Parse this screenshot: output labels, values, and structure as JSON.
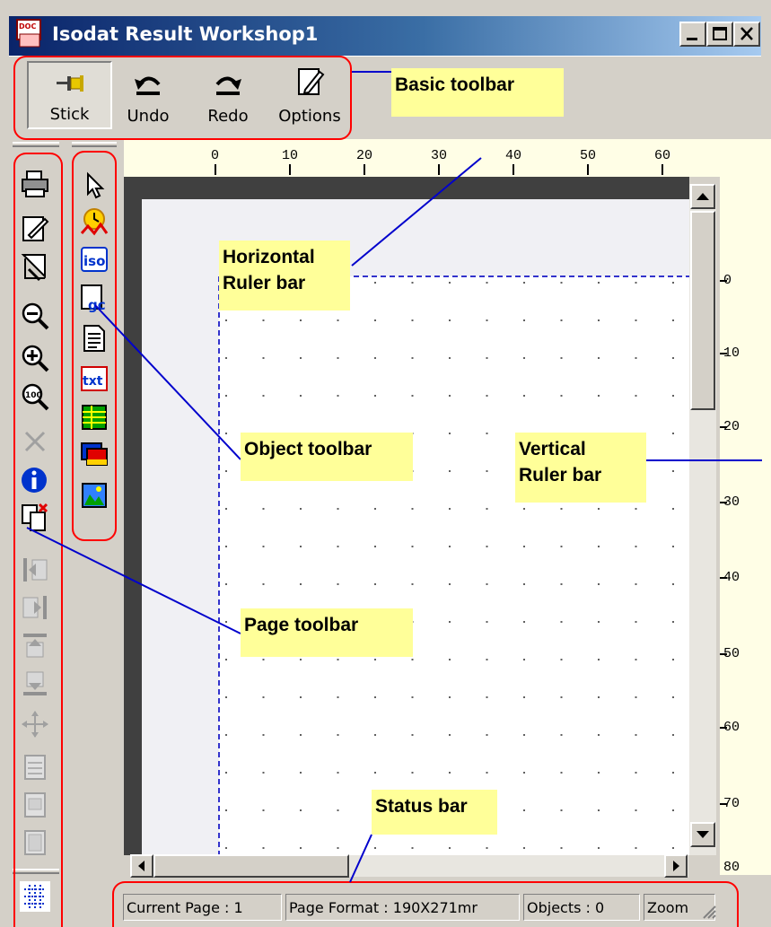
{
  "window": {
    "title": "Isodat Result Workshop1",
    "caption_buttons": {
      "minimize": "_",
      "maximize": "□",
      "close": "×"
    }
  },
  "basic_toolbar": {
    "buttons": [
      {
        "label": "Stick",
        "icon": "pin-icon"
      },
      {
        "label": "Undo",
        "icon": "undo-arrow-icon"
      },
      {
        "label": "Redo",
        "icon": "redo-arrow-icon"
      },
      {
        "label": "Options",
        "icon": "notepad-pencil-icon"
      }
    ]
  },
  "page_toolbar": {
    "icons": [
      "print-icon",
      "edit-page-icon",
      "page-select-icon",
      "zoom-out-icon",
      "zoom-in-icon",
      "zoom-100-icon",
      "delete-icon",
      "info-icon",
      "copy-page-icon",
      "move-left-icon",
      "move-right-icon",
      "move-up-icon",
      "move-down-icon",
      "move-center-icon",
      "page-layout-1-icon",
      "page-layout-2-icon",
      "page-layout-3-icon",
      "grid-icon"
    ]
  },
  "object_toolbar": {
    "icons": [
      "pointer-icon",
      "chromatogram-icon",
      "iso-object-icon",
      "gc-object-icon",
      "text-document-icon",
      "txt-object-icon",
      "table-object-icon",
      "image-object-icon",
      "picture-object-icon"
    ]
  },
  "horizontal_ruler": {
    "labels": [
      "0",
      "10",
      "20",
      "30",
      "40",
      "50",
      "60"
    ]
  },
  "vertical_ruler": {
    "labels": [
      "0",
      "10",
      "20",
      "30",
      "40",
      "50",
      "60",
      "70",
      "80"
    ]
  },
  "status_bar": {
    "current_page": "Current Page : 1",
    "page_format": "Page Format : 190X271mr",
    "objects": "Objects : 0",
    "zoom": "Zoom"
  },
  "annotations": {
    "basic_toolbar": "Basic toolbar",
    "horizontal_ruler_1": "Horizontal",
    "horizontal_ruler_2": "Ruler bar",
    "object_toolbar": "Object toolbar",
    "vertical_ruler_1": "Vertical",
    "vertical_ruler_2": "Ruler bar",
    "page_toolbar": "Page toolbar",
    "status_bar": "Status bar"
  },
  "colors": {
    "titlebar_start": "#0a246a",
    "titlebar_end": "#a6caf0",
    "annotation_box": "#ff0000",
    "callout_line": "#0000cc",
    "note_bg": "#ffff99",
    "ruler_bg": "#fffee6"
  }
}
